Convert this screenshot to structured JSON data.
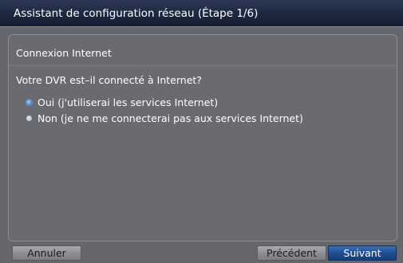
{
  "window": {
    "title": "Assistant de configuration réseau (Étape 1/6)"
  },
  "main": {
    "section_title": "Connexion Internet",
    "question": "Votre DVR est–il connecté à Internet?",
    "options": [
      {
        "label": "Oui (j'utiliserai les services Internet)",
        "selected": true
      },
      {
        "label": "Non (je ne me connecterai pas aux services Internet)",
        "selected": false
      }
    ]
  },
  "buttons": {
    "cancel_label": "Annuler",
    "prev_label": "Précédent",
    "next_label": "Suivant"
  },
  "colors": {
    "titlebar": "#1d2740",
    "panel": "#66676c",
    "accent_button": "#1f4f92",
    "radio_selected": "#3f8fe3"
  }
}
